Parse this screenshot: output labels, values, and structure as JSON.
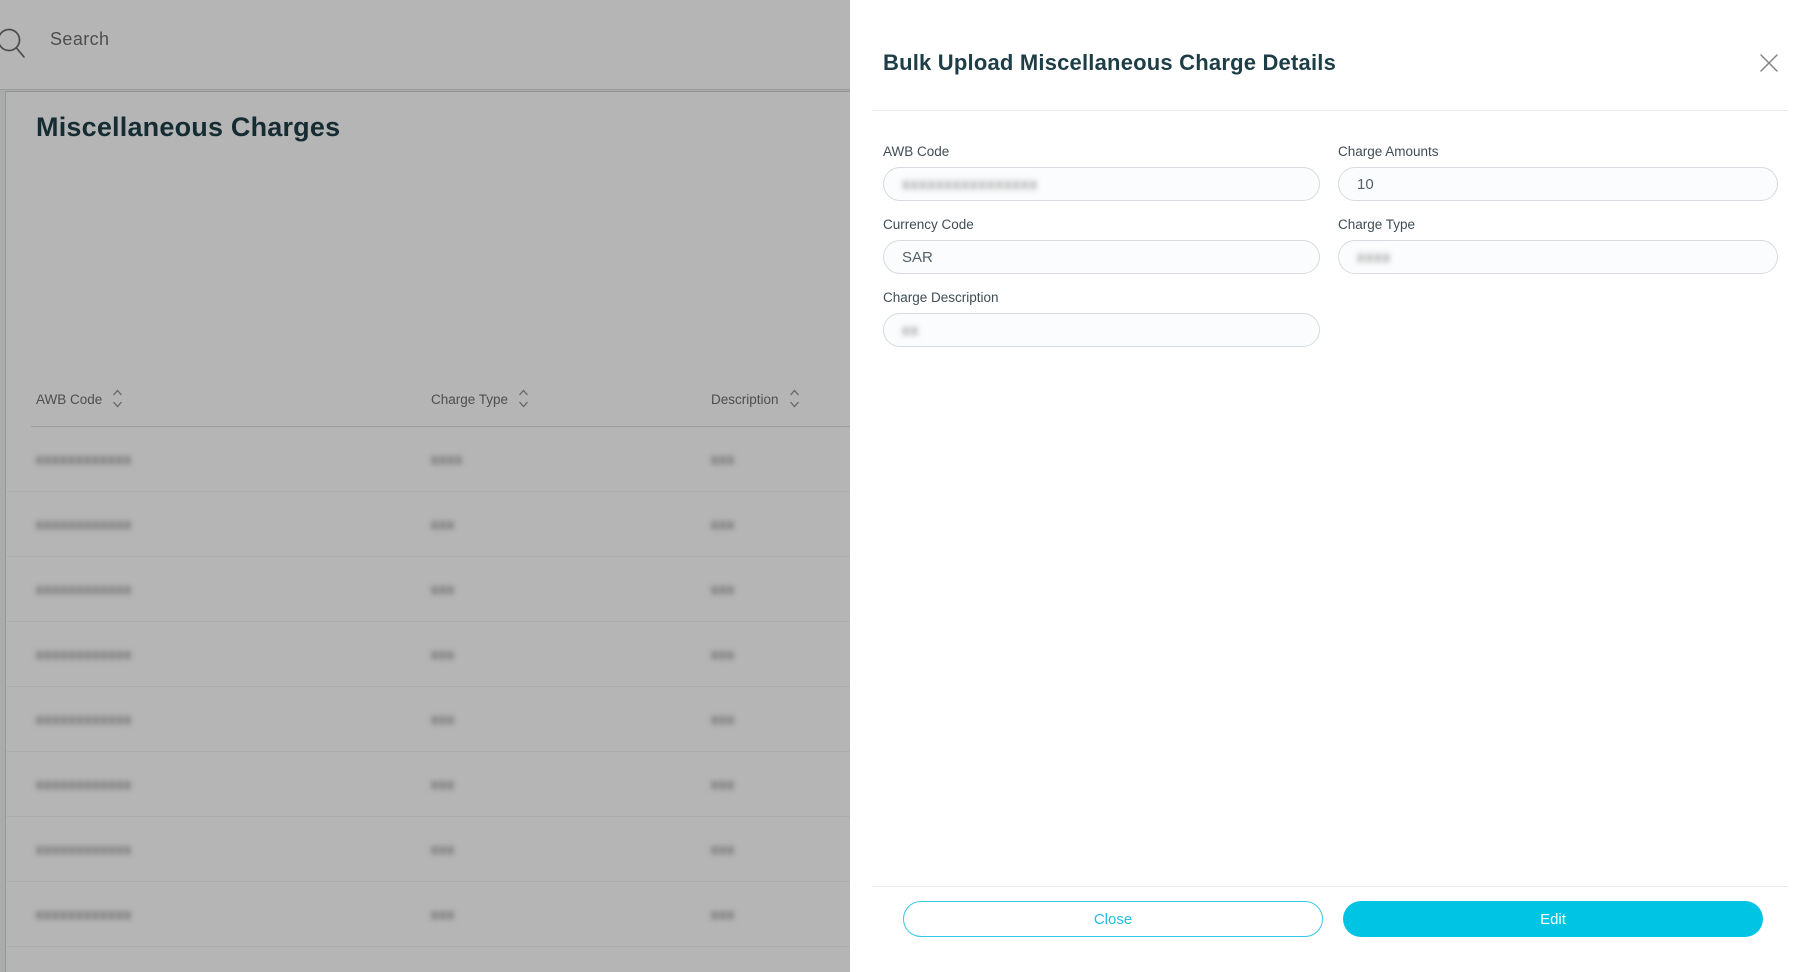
{
  "colors": {
    "accent": "#00C4E4",
    "accent_light": "#35C8E8",
    "title_teal": "#1D3E47"
  },
  "page": {
    "search": {
      "placeholder": "Search"
    },
    "title": "Miscellaneous Charges",
    "table": {
      "headers": [
        "AWB Code",
        "Charge Type",
        "Description"
      ],
      "rows": [
        {
          "awb_code": "xxxxxxxxxxxx",
          "charge_type": "xxxx",
          "description": "xxx"
        },
        {
          "awb_code": "xxxxxxxxxxxx",
          "charge_type": "xxx",
          "description": "xxx"
        },
        {
          "awb_code": "xxxxxxxxxxxx",
          "charge_type": "xxx",
          "description": "xxx"
        },
        {
          "awb_code": "xxxxxxxxxxxx",
          "charge_type": "xxx",
          "description": "xxx"
        },
        {
          "awb_code": "xxxxxxxxxxxx",
          "charge_type": "xxx",
          "description": "xxx"
        },
        {
          "awb_code": "xxxxxxxxxxxx",
          "charge_type": "xxx",
          "description": "xxx"
        },
        {
          "awb_code": "xxxxxxxxxxxx",
          "charge_type": "xxx",
          "description": "xxx"
        },
        {
          "awb_code": "xxxxxxxxxxxx",
          "charge_type": "xxx",
          "description": "xxx"
        }
      ]
    }
  },
  "modal": {
    "title": "Bulk Upload Miscellaneous Charge Details",
    "fields": {
      "awb_code": {
        "label": "AWB Code",
        "value": "xxxxxxxxxxxxxxxx",
        "blurred": true
      },
      "charge_amounts": {
        "label": "Charge Amounts",
        "value": "10",
        "blurred": false
      },
      "currency_code": {
        "label": "Currency Code",
        "value": "SAR",
        "blurred": false
      },
      "charge_type": {
        "label": "Charge Type",
        "value": "xxxx",
        "blurred": true
      },
      "charge_description": {
        "label": "Charge Description",
        "value": "xx",
        "blurred": true
      }
    },
    "footer": {
      "close_label": "Close",
      "edit_label": "Edit"
    }
  }
}
